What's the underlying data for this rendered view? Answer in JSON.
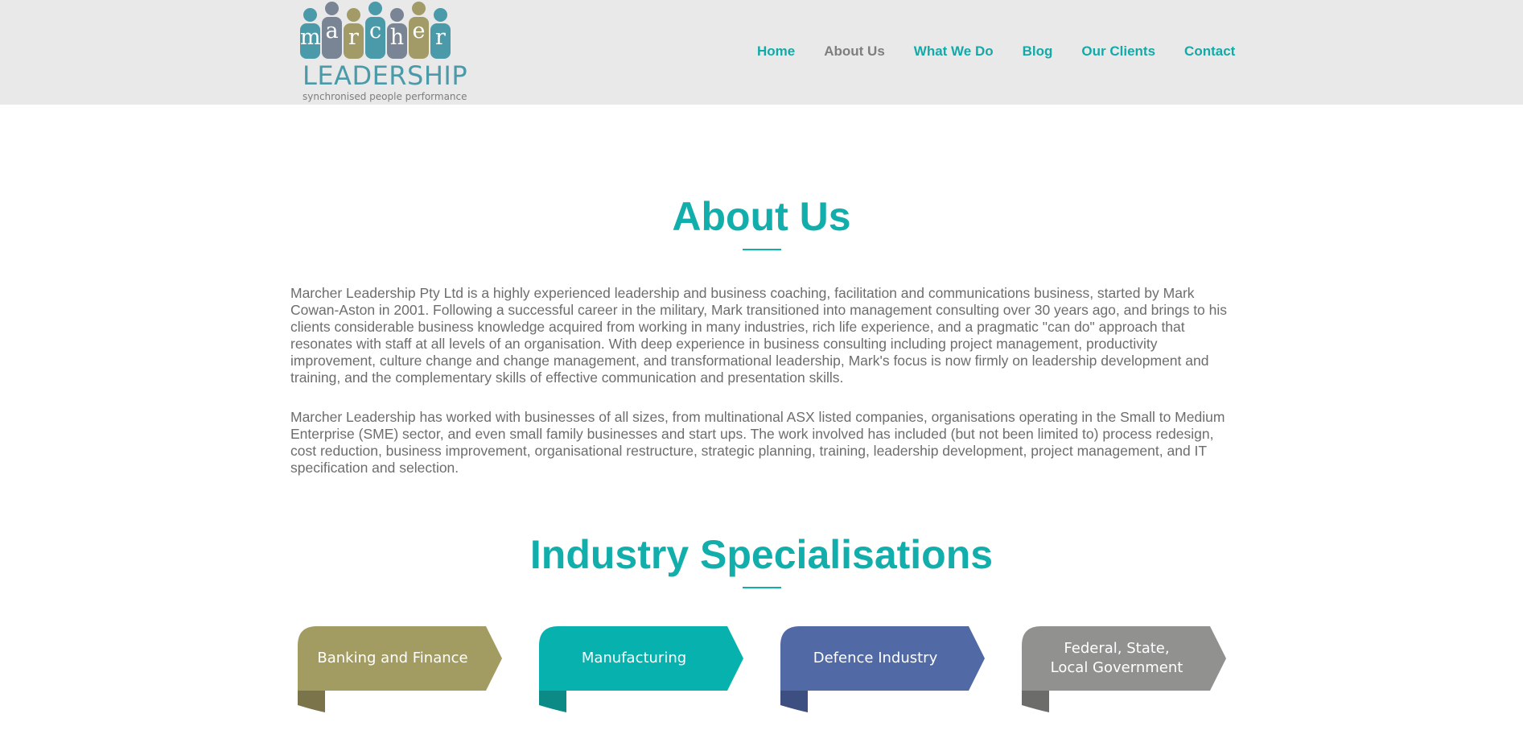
{
  "logo": {
    "letters": [
      "m",
      "a",
      "r",
      "c",
      "h",
      "e",
      "r"
    ],
    "word": "LEADERSHIP",
    "tagline": "synchronised people performance"
  },
  "nav": [
    {
      "label": "Home",
      "active": false
    },
    {
      "label": "About Us",
      "active": true
    },
    {
      "label": "What We Do",
      "active": false
    },
    {
      "label": "Blog",
      "active": false
    },
    {
      "label": "Our Clients",
      "active": false
    },
    {
      "label": "Contact",
      "active": false
    }
  ],
  "about": {
    "title": "About Us",
    "paragraphs": [
      "Marcher Leadership Pty Ltd is a highly experienced leadership and business coaching, facilitation and communications business, started by Mark Cowan-Aston in 2001. Following a successful career in the military, Mark transitioned into management consulting over 30 years ago, and brings to his clients considerable business knowledge acquired from working in many industries, rich life experience, and a pragmatic \"can do\" approach that resonates with staff at all levels of an organisation. With deep experience in business consulting including project management, productivity improvement, culture change and change management, and transformational leadership, Mark's focus is now firmly on leadership development and training, and the complementary skills of effective communication and presentation skills.",
      "Marcher Leadership has worked with businesses of all sizes, from multinational ASX listed companies, organisations operating in the Small to Medium Enterprise (SME) sector, and even small family businesses and start ups. The work involved has included (but not been limited to) process redesign, cost reduction, business improvement, organisational restructure, strategic planning, training, leadership development, project management, and IT specification and selection."
    ]
  },
  "industry": {
    "title": "Industry Specialisations",
    "items": [
      {
        "label": "Banking and Finance",
        "color": "#a39c62",
        "fold": "#7b744a"
      },
      {
        "label": "Manufacturing",
        "color": "#07b1ae",
        "fold": "#0b8a86"
      },
      {
        "label": "Defence Industry",
        "color": "#5169a4",
        "fold": "#3c4f80"
      },
      {
        "label": "Federal, State,\nLocal Government",
        "color": "#919190",
        "fold": "#6c6c6b"
      }
    ]
  },
  "colors": {
    "accent": "#12aeab",
    "header_bg": "#e9e9e9",
    "nav_active": "#7e7e7e",
    "body_text": "#6d6d6d",
    "logo_teal": "#4a9aa9",
    "logo_slate": "#798594",
    "logo_olive": "#a29b68"
  }
}
